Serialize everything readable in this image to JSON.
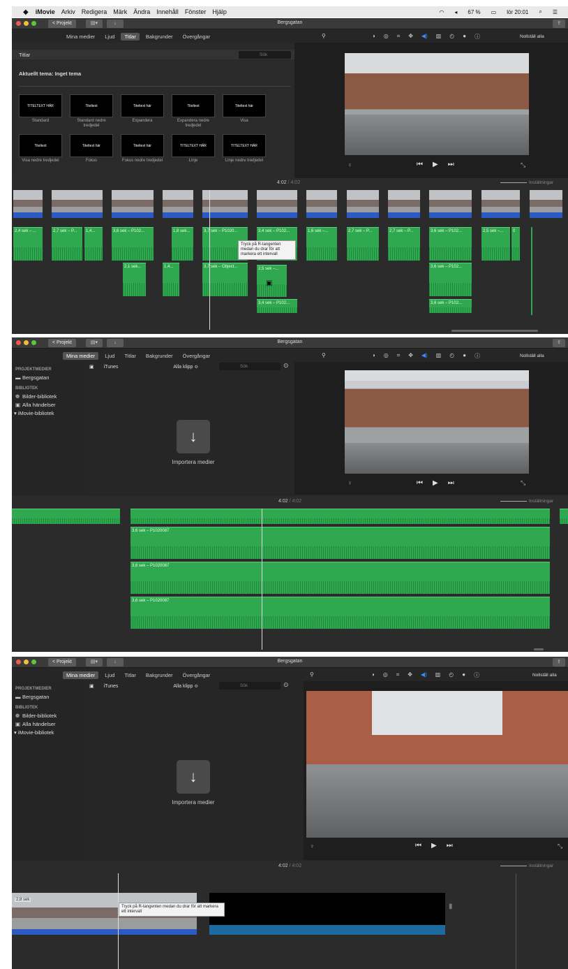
{
  "menubar": {
    "apple": "",
    "items": [
      "iMovie",
      "Arkiv",
      "Redigera",
      "Märk",
      "Ändra",
      "Innehåll",
      "Fönster",
      "Hjälp"
    ],
    "battery": "67 %",
    "clock": "lör 20:01"
  },
  "window": {
    "project_button": "< Projekt",
    "title": "Bergsgatan"
  },
  "tabs": [
    "Mina medier",
    "Ljud",
    "Titlar",
    "Bakgrunder",
    "Övergångar"
  ],
  "toolbar": {
    "reset_all": "Nollställ alla"
  },
  "panel1": {
    "active_tab": "Titlar",
    "browser_header": "Titlar",
    "search_placeholder": "Sök",
    "theme_label": "Aktuellt tema: Inget tema",
    "titles": [
      {
        "label": "Standard",
        "thumb": "TITELTEXT HÄR"
      },
      {
        "label": "Standard nedre tredjedel",
        "thumb": "Titeltext"
      },
      {
        "label": "Expandera",
        "thumb": "Titeltext här"
      },
      {
        "label": "Expandera nedre tredjedel",
        "thumb": "Titeltext"
      },
      {
        "label": "Visa",
        "thumb": "Titeltext här"
      },
      {
        "label": "Visa nedre tredjedel",
        "thumb": "Titeltext"
      },
      {
        "label": "Fokus",
        "thumb": "Titeltext här"
      },
      {
        "label": "Fokus nedre tredjedel",
        "thumb": "Titeltext här"
      },
      {
        "label": "Linje",
        "thumb": "TITELTEXT HÄR"
      },
      {
        "label": "Linje nedre tredjedel",
        "thumb": "TITELTEXT HÄR"
      }
    ],
    "timecode_current": "4:02",
    "timecode_total": "4:02",
    "zoom_label": "Inställningar",
    "audio_clips": [
      "2,4 sek – ...",
      "2,7 sek – P...",
      "1,4...",
      "3,6 sek – P102...",
      "1,8 sek...",
      "3,7 sek – P1020...",
      "3,4 sek – P102...",
      "1,6 sek –...",
      "2,7 sek – P...",
      "2,7 sek – P...",
      "3,6 sek – P102...",
      "2,5 sek –...",
      "0"
    ],
    "audio_row2": [
      "2,1 sek...",
      "1,4...",
      "3,7 sek – Object...",
      "2,5 sek –...",
      "3,6 sek – P102..."
    ],
    "audio_row3": [
      "3,4 sek – P102...",
      "3,6 sek – P102..."
    ],
    "tooltip": "Tryck på R-tangenten medan du drar för att markera ett intervall"
  },
  "panel2": {
    "active_tab": "Mina medier",
    "sidebar": {
      "projects_header": "PROJEKTMEDIER",
      "project": "Bergsgatan",
      "library_header": "BIBLIOTEK",
      "items": [
        "Bilder-bibliotek",
        "Alla händelser"
      ],
      "imovie_library": "▾ iMovie-bibliotek"
    },
    "source": "iTunes",
    "filter": "Alla klipp ≎",
    "search_placeholder": "Sök",
    "import_label": "Importera medier",
    "timecode_current": "4:02",
    "timecode_total": "4:02",
    "zoom_label": "Inställningar",
    "audio_labels": [
      "3,6 sek – P1020087",
      "3,6 sek – P1020087",
      "3,6 sek – P1020087"
    ]
  },
  "panel3": {
    "timecode_current": "4:02",
    "timecode_total": "4:02",
    "zoom_label": "Inställningar",
    "clip_label": "2,8 sek",
    "tooltip": "Tryck på R-tangenten medan du drar för att markera ett intervall"
  },
  "colors": {
    "panel_bg": "#262626",
    "audio_green": "#2fa84f",
    "video_blue": "#2a5ac2",
    "accent_blue": "#3d8bfd"
  }
}
